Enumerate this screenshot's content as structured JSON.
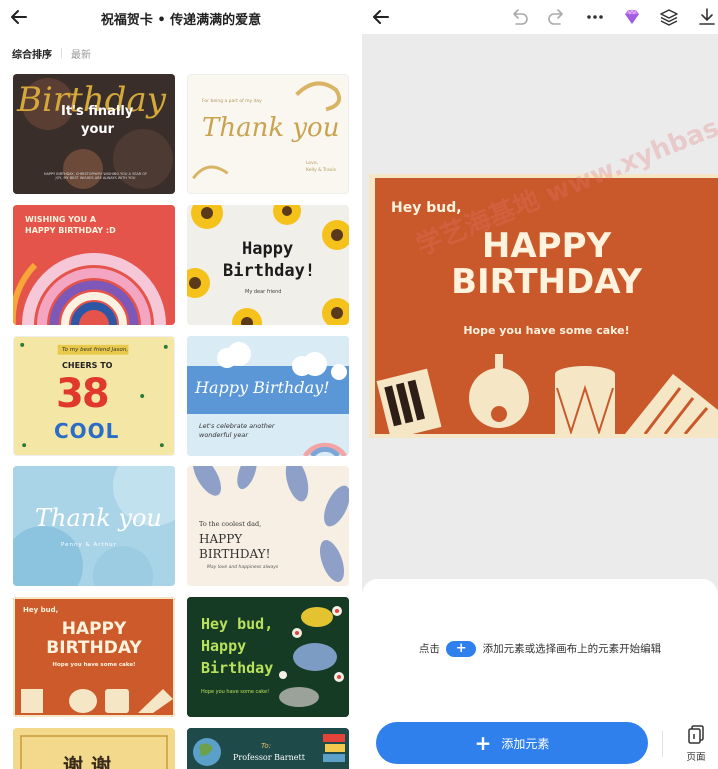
{
  "left_panel": {
    "title": "祝福贺卡 • 传递满满的爱意",
    "sort_tabs": [
      "综合排序",
      "最新"
    ],
    "cards": [
      {
        "lines": [
          "Birthday",
          "It's finally",
          "your",
          "HAPPY BIRTHDAY, CHRISTOPHER! WISHING YOU A YEAR OF JOY, MY BEST WISHES ARE ALWAYS WITH YOU"
        ]
      },
      {
        "lines": [
          "Thank you",
          "For being a part of my day",
          "Love,",
          "Kelly & Travis"
        ]
      },
      {
        "lines": [
          "WISHING YOU A",
          "HAPPY BIRTHDAY :D"
        ]
      },
      {
        "lines": [
          "Happy",
          "Birthday!",
          "My dear friend"
        ]
      },
      {
        "lines": [
          "To my best friend Jason,",
          "CHEERS TO",
          "38",
          "COOL"
        ]
      },
      {
        "lines": [
          "Happy Birthday!",
          "Let's celebrate another",
          "wonderful year"
        ]
      },
      {
        "lines": [
          "Thank you",
          "Penny & Arthur"
        ]
      },
      {
        "lines": [
          "To the coolest dad,",
          "HAPPY",
          "BIRTHDAY!",
          "May love and happiness always"
        ]
      },
      {
        "lines": [
          "Hey bud,",
          "HAPPY",
          "BIRTHDAY",
          "Hope you have some cake!"
        ]
      },
      {
        "lines": [
          "Hey bud,",
          "Happy",
          "Birthday",
          "Hope you have some cake!"
        ]
      },
      {
        "lines": [
          "谢谢"
        ]
      },
      {
        "lines": [
          "To:",
          "Professor Barnett"
        ]
      }
    ]
  },
  "editor": {
    "toolbar_icons": [
      "back-arrow-icon",
      "undo-icon",
      "redo-icon",
      "more-icon",
      "premium-gem-icon",
      "layers-icon",
      "download-icon"
    ],
    "card": {
      "greeting": "Hey bud,",
      "line1": "HAPPY",
      "line2": "BIRTHDAY",
      "subtitle": "Hope you have some cake!"
    },
    "watermark": "学艺海基地 www.xyhbase.com",
    "hint_before": "点击",
    "hint_after": "添加元素或选择画布上的元素开始编辑",
    "add_button_label": "添加元素",
    "page_button_label": "页面"
  }
}
